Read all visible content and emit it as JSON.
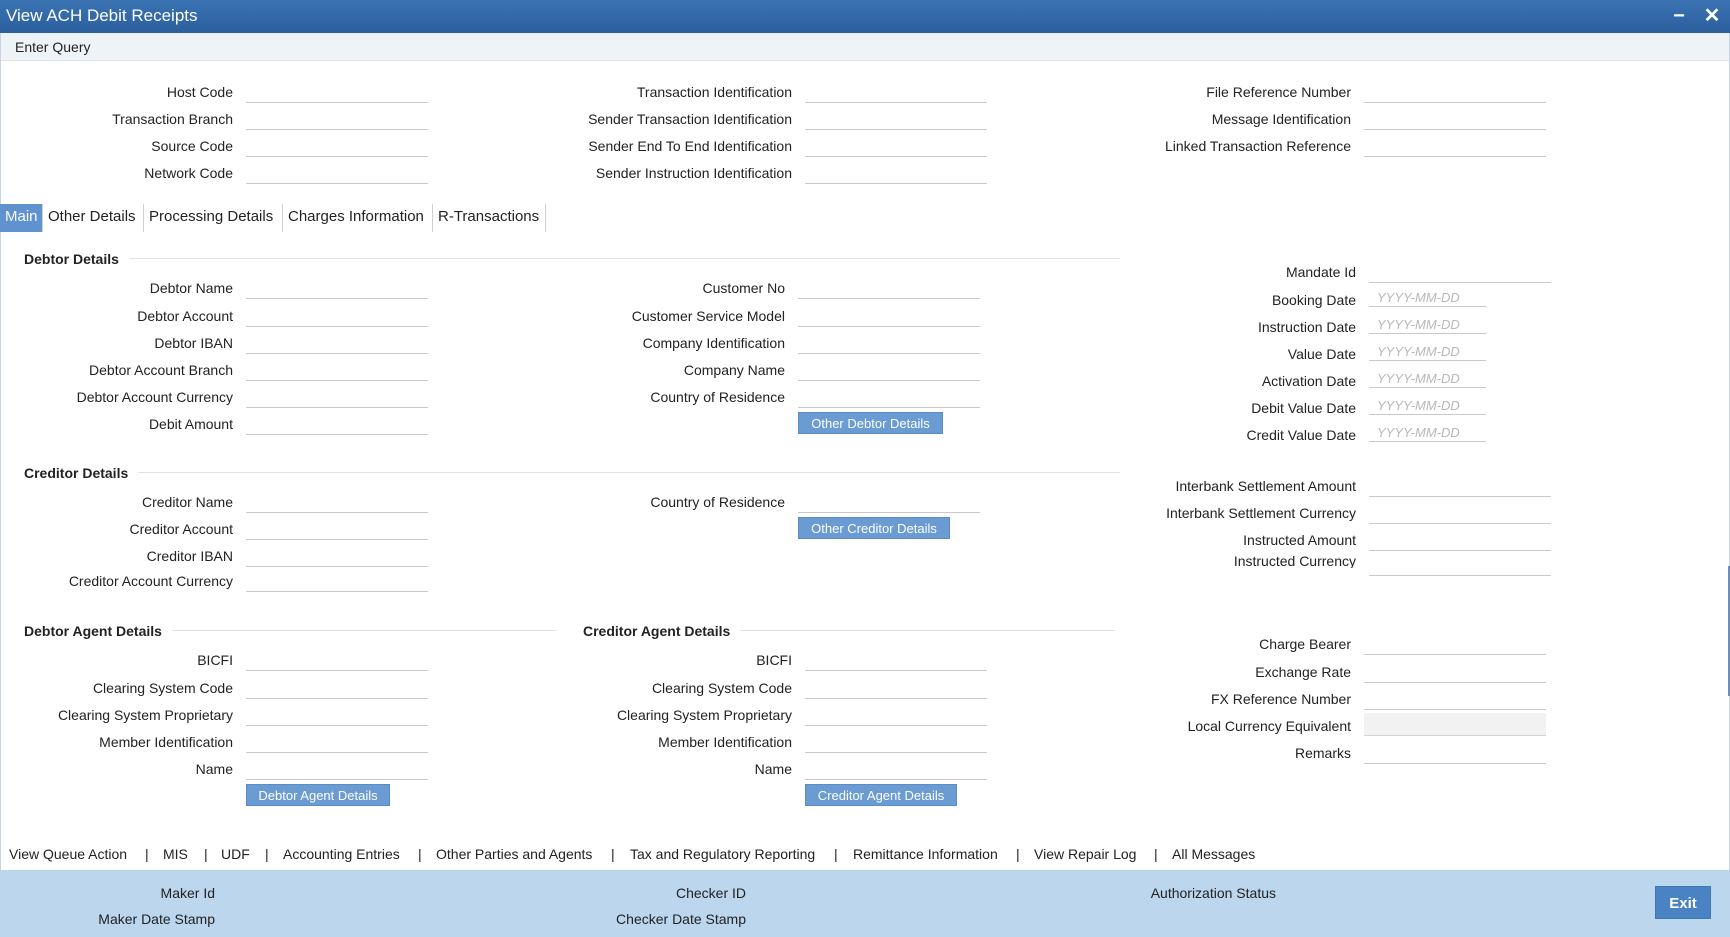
{
  "window": {
    "title": "View ACH Debit Receipts",
    "minimize_glyph": "−",
    "close_glyph": "✕"
  },
  "menu": {
    "enter_query": "Enter Query"
  },
  "header": {
    "host_code": "Host Code",
    "transaction_branch": "Transaction Branch",
    "source_code": "Source Code",
    "network_code": "Network Code",
    "transaction_identification": "Transaction Identification",
    "sender_transaction_identification": "Sender Transaction Identification",
    "sender_end_to_end_identification": "Sender End To End Identification",
    "sender_instruction_identification": "Sender Instruction Identification",
    "file_reference_number": "File Reference Number",
    "message_identification": "Message Identification",
    "linked_transaction_reference": "Linked Transaction Reference"
  },
  "tabs": [
    "Main",
    "Other Details",
    "Processing Details",
    "Charges Information",
    "R-Transactions"
  ],
  "debtor": {
    "section": "Debtor Details",
    "debtor_name": "Debtor Name",
    "debtor_account": "Debtor Account",
    "debtor_iban": "Debtor IBAN",
    "debtor_account_branch": "Debtor Account Branch",
    "debtor_account_currency": "Debtor Account Currency",
    "debit_amount": "Debit Amount",
    "customer_no": "Customer No",
    "customer_service_model": "Customer Service Model",
    "company_identification": "Company Identification",
    "company_name": "Company Name",
    "country_of_residence": "Country of Residence",
    "other_debtor_details": "Other Debtor Details"
  },
  "dates": {
    "mandate_id": "Mandate Id",
    "booking_date": "Booking Date",
    "instruction_date": "Instruction Date",
    "value_date": "Value Date",
    "activation_date": "Activation Date",
    "debit_value_date": "Debit Value Date",
    "credit_value_date": "Credit Value Date",
    "date_placeholder": "YYYY-MM-DD"
  },
  "creditor": {
    "section": "Creditor Details",
    "creditor_name": "Creditor Name",
    "creditor_account": "Creditor Account",
    "creditor_iban": "Creditor IBAN",
    "creditor_account_currency": "Creditor Account Currency",
    "country_of_residence": "Country of Residence",
    "other_creditor_details": "Other Creditor Details"
  },
  "amounts": {
    "interbank_settlement_amount": "Interbank Settlement Amount",
    "interbank_settlement_currency": "Interbank Settlement Currency",
    "instructed_amount": "Instructed Amount",
    "instructed_currency": "Instructed Currency"
  },
  "debtor_agent": {
    "section": "Debtor Agent Details",
    "bicfi": "BICFI",
    "clearing_system_code": "Clearing System Code",
    "clearing_system_proprietary": "Clearing System Proprietary",
    "member_identification": "Member Identification",
    "name": "Name",
    "button": "Debtor Agent Details"
  },
  "creditor_agent": {
    "section": "Creditor Agent Details",
    "bicfi": "BICFI",
    "clearing_system_code": "Clearing System Code",
    "clearing_system_proprietary": "Clearing System Proprietary",
    "member_identification": "Member Identification",
    "name": "Name",
    "button": "Creditor Agent Details"
  },
  "charges": {
    "charge_bearer": "Charge Bearer",
    "exchange_rate": "Exchange Rate",
    "fx_reference_number": "FX Reference Number",
    "local_currency_equivalent": "Local Currency Equivalent",
    "remarks": "Remarks"
  },
  "bottom_links": [
    "View Queue Action",
    "MIS",
    "UDF",
    "Accounting Entries",
    "Other Parties and Agents",
    "Tax and Regulatory Reporting",
    "Remittance Information",
    "View Repair Log",
    "All Messages"
  ],
  "footer": {
    "maker_id": "Maker Id",
    "maker_date_stamp": "Maker Date Stamp",
    "checker_id": "Checker ID",
    "checker_date_stamp": "Checker Date Stamp",
    "authorization_status": "Authorization Status",
    "exit": "Exit"
  }
}
